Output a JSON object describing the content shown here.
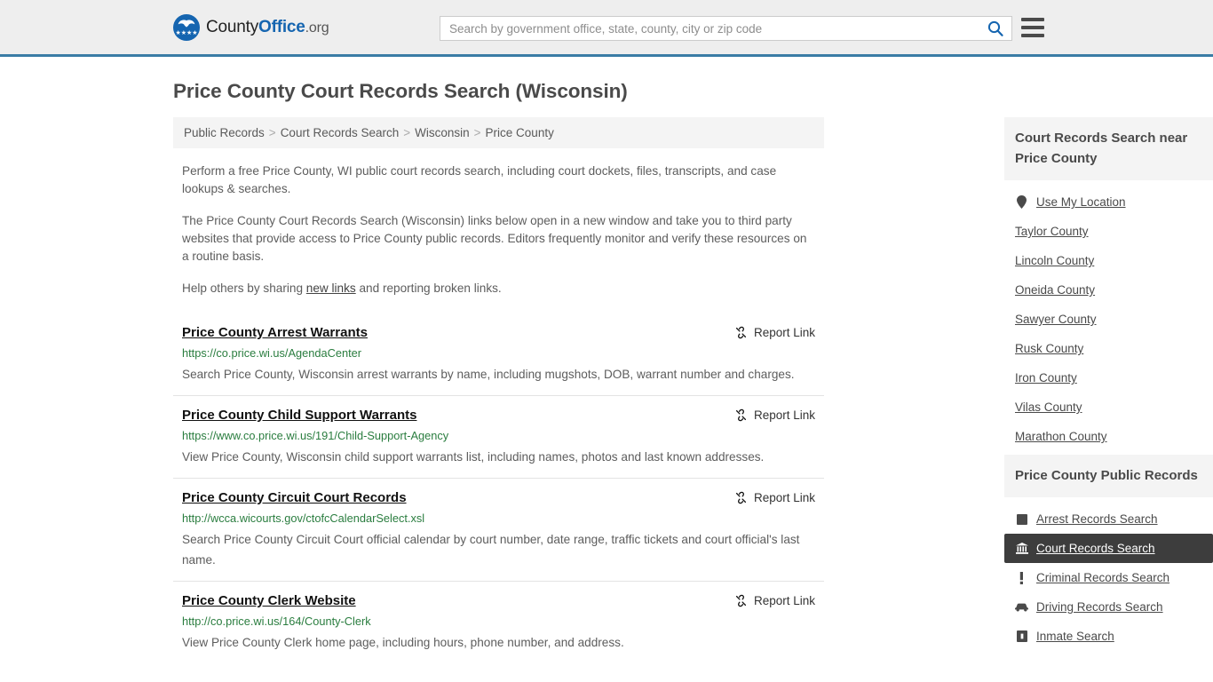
{
  "header": {
    "logo": {
      "icon": "eagle-shield-icon",
      "text_part1": "County",
      "text_part2": "Office",
      "text_part3": ".org"
    },
    "search": {
      "placeholder": "Search by government office, state, county, city or zip code",
      "value": "",
      "search_icon": "search-icon"
    },
    "menu_icon": "hamburger-menu-icon",
    "accent_color": "#3a7ca5"
  },
  "page": {
    "title": "Price County Court Records Search (Wisconsin)"
  },
  "breadcrumb": {
    "separator": ">",
    "items": [
      {
        "label": "Public Records"
      },
      {
        "label": "Court Records Search"
      },
      {
        "label": "Wisconsin"
      },
      {
        "label": "Price County"
      }
    ]
  },
  "intro": {
    "p1": "Perform a free Price County, WI public court records search, including court dockets, files, transcripts, and case lookups & searches.",
    "p2": "The Price County Court Records Search (Wisconsin) links below open in a new window and take you to third party websites that provide access to Price County public records. Editors frequently monitor and verify these resources on a routine basis.",
    "p3_before": "Help others by sharing ",
    "p3_link": "new links",
    "p3_after": " and reporting broken links."
  },
  "results": {
    "report_label": "Report Link",
    "report_icon": "broken-link-icon",
    "items": [
      {
        "title": "Price County Arrest Warrants",
        "url": "https://co.price.wi.us/AgendaCenter",
        "desc": "Search Price County, Wisconsin arrest warrants by name, including mugshots, DOB, warrant number and charges."
      },
      {
        "title": "Price County Child Support Warrants",
        "url": "https://www.co.price.wi.us/191/Child-Support-Agency",
        "desc": "View Price County, Wisconsin child support warrants list, including names, photos and last known addresses."
      },
      {
        "title": "Price County Circuit Court Records",
        "url": "http://wcca.wicourts.gov/ctofcCalendarSelect.xsl",
        "desc": "Search Price County Circuit Court official calendar by court number, date range, traffic tickets and court official's last name."
      },
      {
        "title": "Price County Clerk Website",
        "url": "http://co.price.wi.us/164/County-Clerk",
        "desc": "View Price County Clerk home page, including hours, phone number, and address."
      }
    ]
  },
  "sidebar": {
    "nearby": {
      "heading": "Court Records Search near Price County",
      "use_my_location": {
        "label": "Use My Location",
        "icon": "map-pin-icon"
      },
      "counties": [
        {
          "label": "Taylor County"
        },
        {
          "label": "Lincoln County"
        },
        {
          "label": "Oneida County"
        },
        {
          "label": "Sawyer County"
        },
        {
          "label": "Rusk County"
        },
        {
          "label": "Iron County"
        },
        {
          "label": "Vilas County"
        },
        {
          "label": "Marathon County"
        }
      ]
    },
    "public_records": {
      "heading": "Price County Public Records",
      "items": [
        {
          "label": "Arrest Records Search",
          "icon": "square-badge-icon",
          "active": false
        },
        {
          "label": "Court Records Search",
          "icon": "courthouse-icon",
          "active": true
        },
        {
          "label": "Criminal Records Search",
          "icon": "exclamation-icon",
          "active": false
        },
        {
          "label": "Driving Records Search",
          "icon": "car-icon",
          "active": false
        },
        {
          "label": "Inmate Search",
          "icon": "inmate-icon",
          "active": false
        }
      ],
      "active_bg": "#3d3d3d"
    }
  }
}
